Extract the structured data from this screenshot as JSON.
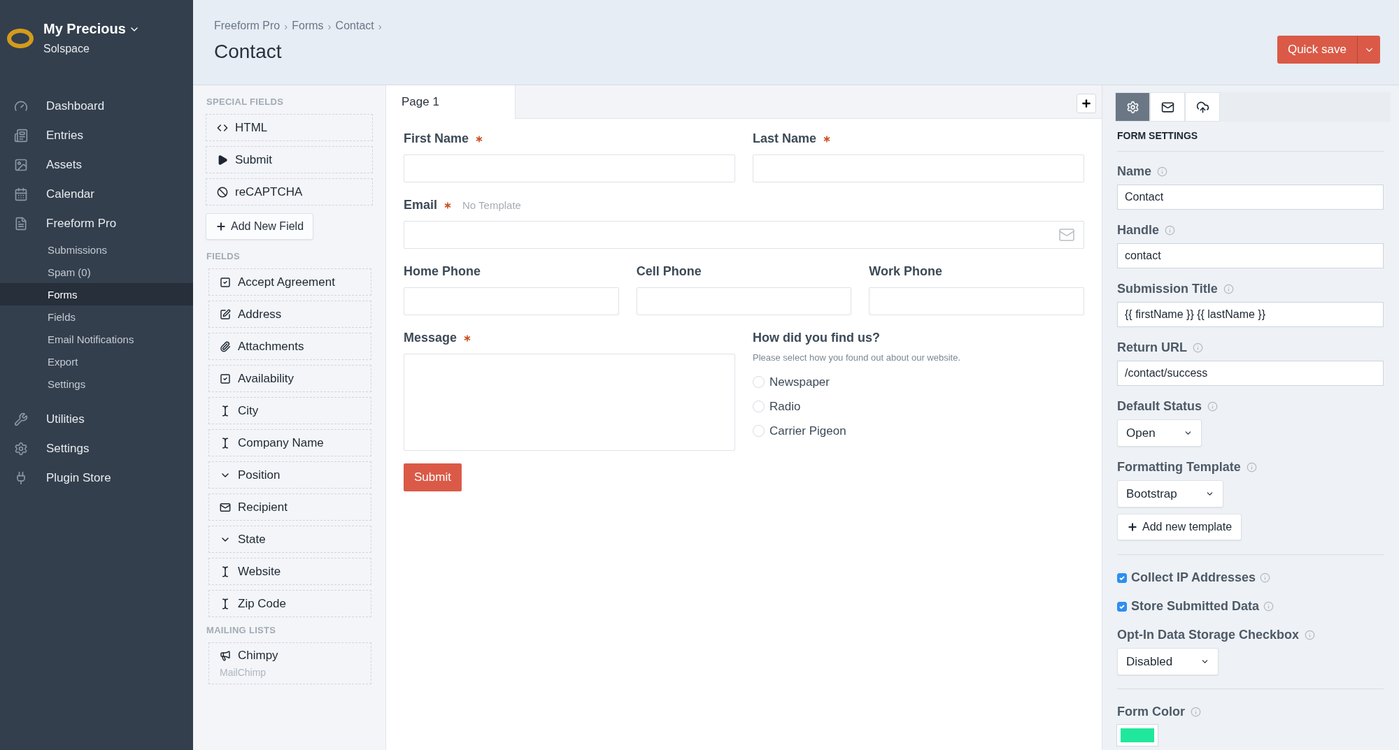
{
  "sidebar": {
    "site": {
      "name": "My Precious",
      "subtitle": "Solspace"
    },
    "items": [
      {
        "label": "Dashboard",
        "selected": false
      },
      {
        "label": "Entries",
        "selected": false
      },
      {
        "label": "Assets",
        "selected": false
      },
      {
        "label": "Calendar",
        "selected": false
      },
      {
        "label": "Freeform Pro",
        "selected": false,
        "children": [
          {
            "label": "Submissions",
            "selected": false
          },
          {
            "label": "Spam (0)",
            "selected": false
          },
          {
            "label": "Forms",
            "selected": true
          },
          {
            "label": "Fields",
            "selected": false
          },
          {
            "label": "Email Notifications",
            "selected": false
          },
          {
            "label": "Export",
            "selected": false
          },
          {
            "label": "Settings",
            "selected": false
          }
        ]
      },
      {
        "label": "Utilities",
        "selected": false
      },
      {
        "label": "Settings",
        "selected": false
      },
      {
        "label": "Plugin Store",
        "selected": false
      }
    ]
  },
  "header": {
    "breadcrumbs": [
      "Freeform Pro",
      "Forms",
      "Contact"
    ],
    "separator": "›",
    "title": "Contact",
    "save_button": "Quick save"
  },
  "palette": {
    "sections": [
      {
        "title": "SPECIAL FIELDS",
        "items": [
          {
            "label": "HTML",
            "kind": "html"
          },
          {
            "label": "Submit",
            "kind": "submit"
          },
          {
            "label": "reCAPTCHA",
            "kind": "recaptcha"
          }
        ],
        "add_button": "Add New Field"
      },
      {
        "title": "FIELDS",
        "items": [
          {
            "label": "Accept Agreement",
            "kind": "checkbox"
          },
          {
            "label": "Address",
            "kind": "textarea"
          },
          {
            "label": "Attachments",
            "kind": "file"
          },
          {
            "label": "Availability",
            "kind": "checkbox"
          },
          {
            "label": "City",
            "kind": "text"
          },
          {
            "label": "Company Name",
            "kind": "text"
          },
          {
            "label": "Position",
            "kind": "select"
          },
          {
            "label": "Recipient",
            "kind": "email"
          },
          {
            "label": "State",
            "kind": "select"
          },
          {
            "label": "Website",
            "kind": "text"
          },
          {
            "label": "Zip Code",
            "kind": "text"
          }
        ]
      },
      {
        "title": "MAILING LISTS",
        "items": [
          {
            "label": "Chimpy",
            "kind": "mailing_list",
            "subtitle": "MailChimp"
          }
        ]
      }
    ]
  },
  "canvas": {
    "pages": [
      {
        "label": "Page 1",
        "selected": true
      }
    ],
    "rows": [
      {
        "fields": [
          {
            "kind": "text",
            "label": "First Name",
            "required": true
          },
          {
            "kind": "text",
            "label": "Last Name",
            "required": true
          }
        ]
      },
      {
        "fields": [
          {
            "kind": "email",
            "label": "Email",
            "required": true,
            "note": "No Template"
          }
        ]
      },
      {
        "fields": [
          {
            "kind": "text",
            "label": "Home Phone",
            "required": false
          },
          {
            "kind": "text",
            "label": "Cell Phone",
            "required": false
          },
          {
            "kind": "text",
            "label": "Work Phone",
            "required": false
          }
        ]
      },
      {
        "fields": [
          {
            "kind": "textarea",
            "label": "Message",
            "required": true
          },
          {
            "kind": "radio",
            "label": "How did you find us?",
            "required": false,
            "instructions": "Please select how you found out about our website.",
            "options": [
              {
                "label": "Newspaper",
                "selected": false
              },
              {
                "label": "Radio",
                "selected": false
              },
              {
                "label": "Carrier Pigeon",
                "selected": false
              }
            ]
          }
        ]
      },
      {
        "fields": [
          {
            "kind": "submit",
            "label": "Submit"
          }
        ]
      }
    ]
  },
  "settings": {
    "tabs": [
      {
        "kind": "settings",
        "selected": true
      },
      {
        "kind": "notifications",
        "selected": false
      },
      {
        "kind": "integrations",
        "selected": false
      }
    ],
    "title": "FORM SETTINGS",
    "items": [
      {
        "kind": "input",
        "label": "Name",
        "value": "Contact"
      },
      {
        "kind": "input",
        "label": "Handle",
        "value": "contact"
      },
      {
        "kind": "input",
        "label": "Submission Title",
        "value": "{{ firstName }} {{ lastName }}"
      },
      {
        "kind": "input",
        "label": "Return URL",
        "value": "/contact/success"
      },
      {
        "kind": "select",
        "label": "Default Status",
        "value": "Open"
      },
      {
        "kind": "select",
        "label": "Formatting Template",
        "value": "Bootstrap"
      },
      {
        "kind": "button",
        "label": "Add new template"
      },
      {
        "kind": "divider"
      },
      {
        "kind": "checkbox",
        "label": "Collect IP Addresses",
        "checked": true
      },
      {
        "kind": "checkbox",
        "label": "Store Submitted Data",
        "checked": true
      },
      {
        "kind": "select",
        "label": "Opt-In Data Storage Checkbox",
        "value": "Disabled"
      },
      {
        "kind": "divider"
      },
      {
        "kind": "color",
        "label": "Form Color",
        "color": "#1fe89c"
      }
    ]
  }
}
